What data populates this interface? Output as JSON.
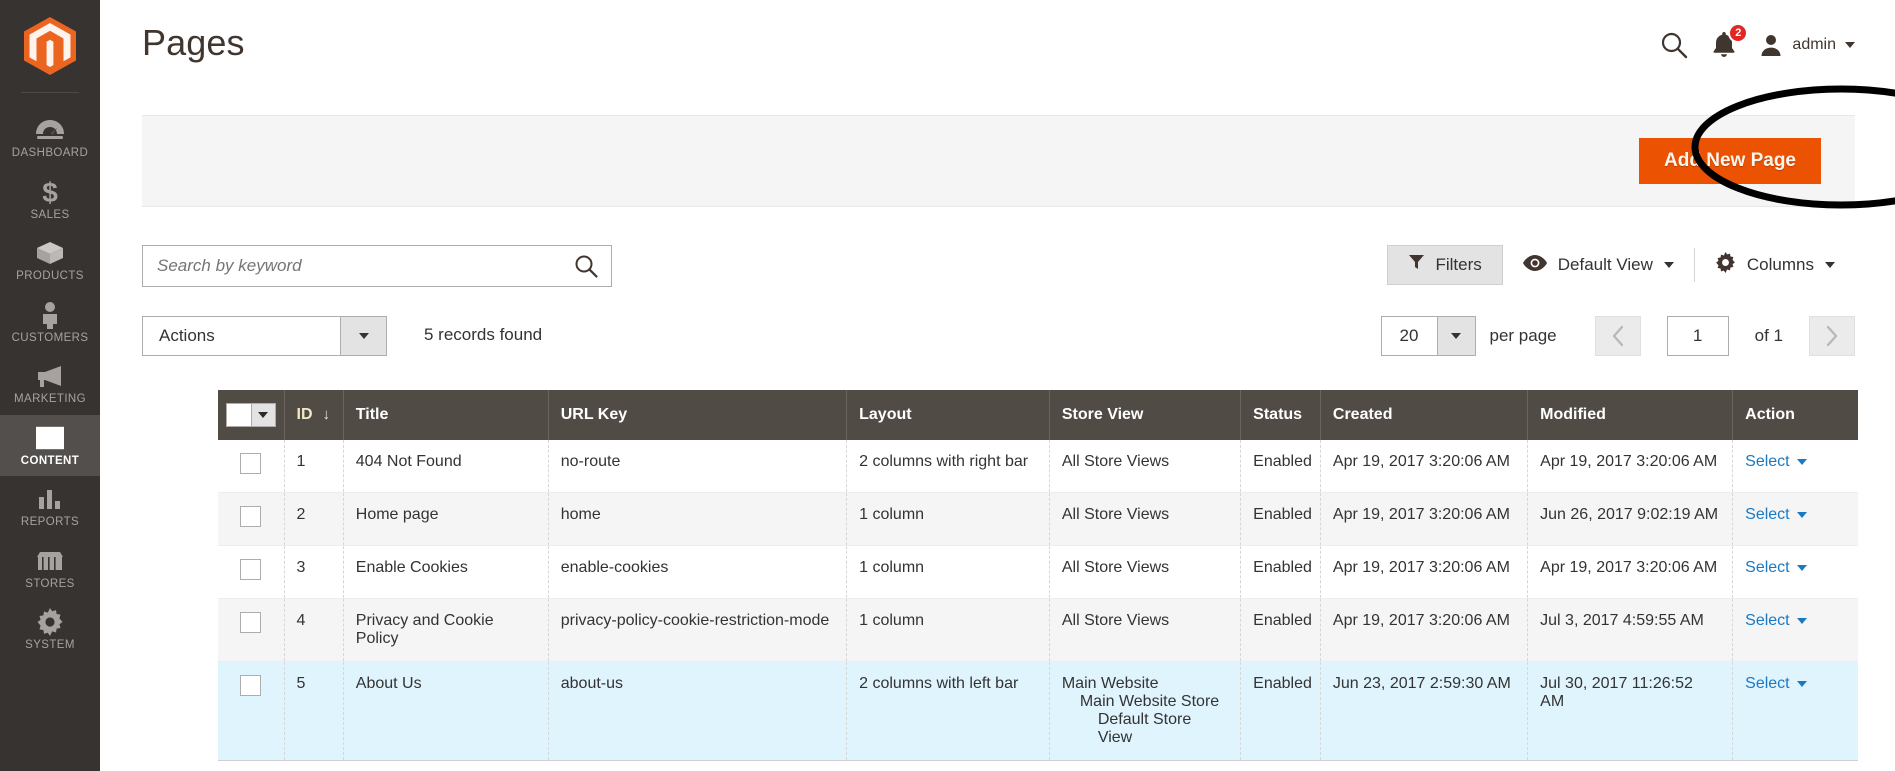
{
  "app": {
    "logo_name": "magento-logo",
    "accent_color": "#eb5202",
    "sidebar_bg": "#373330",
    "link_color": "#1979c3"
  },
  "sidebar": {
    "items": [
      {
        "label": "DASHBOARD",
        "icon": "dashboard-icon",
        "active": false
      },
      {
        "label": "SALES",
        "icon": "dollar-icon",
        "active": false
      },
      {
        "label": "PRODUCTS",
        "icon": "box-icon",
        "active": false
      },
      {
        "label": "CUSTOMERS",
        "icon": "person-icon",
        "active": false
      },
      {
        "label": "MARKETING",
        "icon": "megaphone-icon",
        "active": false
      },
      {
        "label": "CONTENT",
        "icon": "layout-icon",
        "active": true
      },
      {
        "label": "REPORTS",
        "icon": "bar-chart-icon",
        "active": false
      },
      {
        "label": "STORES",
        "icon": "store-icon",
        "active": false
      },
      {
        "label": "SYSTEM",
        "icon": "gear-icon",
        "active": false
      }
    ]
  },
  "header": {
    "title": "Pages",
    "search_icon": "search-icon",
    "notifications": {
      "icon": "bell-icon",
      "count": "2"
    },
    "user": {
      "icon": "avatar-icon",
      "name": "admin",
      "caret": "chevron-down-icon"
    }
  },
  "page_actions": {
    "add_new_label": "Add New Page"
  },
  "annotation": {
    "shape": "ellipse-highlight",
    "color": "#000000",
    "target": "Add New Page"
  },
  "toolbar": {
    "search": {
      "value": "",
      "placeholder": "Search by keyword",
      "icon": "search-icon"
    },
    "filters_label": "Filters",
    "filters_icon": "funnel-icon",
    "view_label": "Default View",
    "view_icon": "eye-icon",
    "columns_label": "Columns",
    "columns_icon": "gear-icon"
  },
  "actions_row": {
    "actions_label": "Actions",
    "records_found": "5 records found",
    "per_page_value": "20",
    "per_page_label": "per page",
    "prev_icon": "chevron-left-icon",
    "next_icon": "chevron-right-icon",
    "page_value": "1",
    "of_label": "of 1"
  },
  "grid": {
    "columns": [
      {
        "key": "check",
        "label": "",
        "sorted": false
      },
      {
        "key": "id",
        "label": "ID",
        "sorted": true,
        "sort_dir": "↓"
      },
      {
        "key": "title",
        "label": "Title",
        "sorted": false
      },
      {
        "key": "url_key",
        "label": "URL Key",
        "sorted": false
      },
      {
        "key": "layout",
        "label": "Layout",
        "sorted": false
      },
      {
        "key": "storeview",
        "label": "Store View",
        "sorted": false
      },
      {
        "key": "status",
        "label": "Status",
        "sorted": false
      },
      {
        "key": "created",
        "label": "Created",
        "sorted": false
      },
      {
        "key": "modified",
        "label": "Modified",
        "sorted": false
      },
      {
        "key": "action",
        "label": "Action",
        "sorted": false
      }
    ],
    "action_link_label": "Select",
    "rows": [
      {
        "id": "1",
        "title": "404 Not Found",
        "url_key": "no-route",
        "layout": "2 columns with right bar",
        "storeview": [
          "All Store Views"
        ],
        "status": "Enabled",
        "created": "Apr 19, 2017 3:20:06 AM",
        "modified": "Apr 19, 2017 3:20:06 AM",
        "highlight": "none"
      },
      {
        "id": "2",
        "title": "Home page",
        "url_key": "home",
        "layout": "1 column",
        "storeview": [
          "All Store Views"
        ],
        "status": "Enabled",
        "created": "Apr 19, 2017 3:20:06 AM",
        "modified": "Jun 26, 2017 9:02:19 AM",
        "highlight": "alt"
      },
      {
        "id": "3",
        "title": "Enable Cookies",
        "url_key": "enable-cookies",
        "layout": "1 column",
        "storeview": [
          "All Store Views"
        ],
        "status": "Enabled",
        "created": "Apr 19, 2017 3:20:06 AM",
        "modified": "Apr 19, 2017 3:20:06 AM",
        "highlight": "none"
      },
      {
        "id": "4",
        "title": "Privacy and Cookie Policy",
        "url_key": "privacy-policy-cookie-restriction-mode",
        "layout": "1 column",
        "storeview": [
          "All Store Views"
        ],
        "status": "Enabled",
        "created": "Apr 19, 2017 3:20:06 AM",
        "modified": "Jul 3, 2017 4:59:55 AM",
        "highlight": "alt"
      },
      {
        "id": "5",
        "title": "About Us",
        "url_key": "about-us",
        "layout": "2 columns with left bar",
        "storeview": [
          "Main Website",
          "Main Website Store",
          "Default Store View"
        ],
        "status": "Enabled",
        "created": "Jun 23, 2017 2:59:30 AM",
        "modified": "Jul 30, 2017 11:26:52 AM",
        "highlight": "selected"
      }
    ]
  }
}
